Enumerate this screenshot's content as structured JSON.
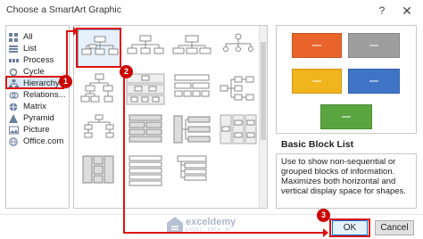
{
  "dialog": {
    "title": "Choose a SmartArt Graphic"
  },
  "categories": [
    {
      "label": "All",
      "icon": "grid-icon"
    },
    {
      "label": "List",
      "icon": "list-icon"
    },
    {
      "label": "Process",
      "icon": "process-icon"
    },
    {
      "label": "Cycle",
      "icon": "cycle-icon"
    },
    {
      "label": "Hierarchy",
      "icon": "hierarchy-icon",
      "selected": true
    },
    {
      "label": "Relations...",
      "icon": "relationship-icon"
    },
    {
      "label": "Matrix",
      "icon": "matrix-icon"
    },
    {
      "label": "Pyramid",
      "icon": "pyramid-icon"
    },
    {
      "label": "Picture",
      "icon": "picture-icon"
    },
    {
      "label": "Office.com",
      "icon": "office-icon"
    }
  ],
  "preview": {
    "title": "Basic Block List",
    "description": "Use to show non-sequential or grouped blocks of information. Maximizes both horizontal and vertical display space for shapes.",
    "colors": [
      "#e8642b",
      "#9e9e9e",
      "#f0b41c",
      "#3f74c6",
      "#5aa540"
    ]
  },
  "buttons": {
    "ok": "OK",
    "cancel": "Cancel"
  },
  "annotations": {
    "step1": "1",
    "step2": "2",
    "step3": "3"
  },
  "watermark": {
    "name": "exceldemy",
    "tagline": "EXCEL · DATA · BI"
  },
  "icons": {
    "help": "?",
    "close": "✕"
  }
}
